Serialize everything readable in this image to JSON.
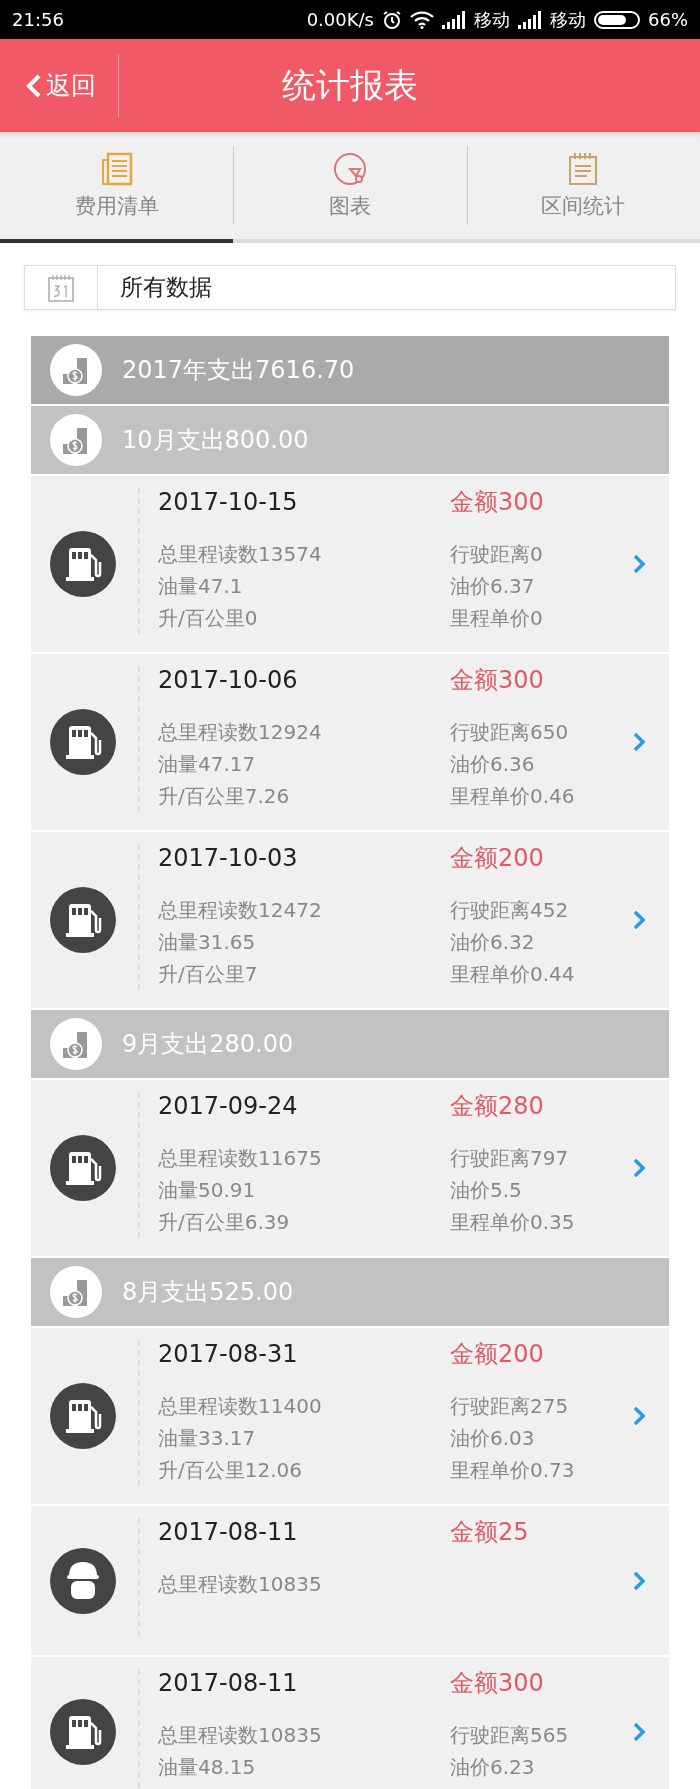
{
  "status_bar": {
    "time": "21:56",
    "speed": "0.00K/s",
    "carriers": [
      "移动",
      "移动"
    ],
    "battery": "66%"
  },
  "header": {
    "back": "返回",
    "title": "统计报表"
  },
  "tabs": [
    {
      "label": "费用清单",
      "selected": true
    },
    {
      "label": "图表",
      "selected": false
    },
    {
      "label": "区间统计",
      "selected": false
    }
  ],
  "date_filter": {
    "value": "所有数据"
  },
  "year_summary": "2017年支出7616.70",
  "months": [
    {
      "summary": "10月支出800.00",
      "entries": [
        {
          "kind": "fuel",
          "date": "2017-10-15",
          "amount": "金额300",
          "left": [
            "总里程读数13574",
            "油量47.1",
            "升/百公里0"
          ],
          "right": [
            "行驶距离0",
            "油价6.37",
            "里程单价0"
          ]
        },
        {
          "kind": "fuel",
          "date": "2017-10-06",
          "amount": "金额300",
          "left": [
            "总里程读数12924",
            "油量47.17",
            "升/百公里7.26"
          ],
          "right": [
            "行驶距离650",
            "油价6.36",
            "里程单价0.46"
          ]
        },
        {
          "kind": "fuel",
          "date": "2017-10-03",
          "amount": "金额200",
          "left": [
            "总里程读数12472",
            "油量31.65",
            "升/百公里7"
          ],
          "right": [
            "行驶距离452",
            "油价6.32",
            "里程单价0.44"
          ]
        }
      ]
    },
    {
      "summary": "9月支出280.00",
      "entries": [
        {
          "kind": "fuel",
          "date": "2017-09-24",
          "amount": "金额280",
          "left": [
            "总里程读数11675",
            "油量50.91",
            "升/百公里6.39"
          ],
          "right": [
            "行驶距离797",
            "油价5.5",
            "里程单价0.35"
          ]
        }
      ]
    },
    {
      "summary": "8月支出525.00",
      "entries": [
        {
          "kind": "fuel",
          "date": "2017-08-31",
          "amount": "金额200",
          "left": [
            "总里程读数11400",
            "油量33.17",
            "升/百公里12.06"
          ],
          "right": [
            "行驶距离275",
            "油价6.03",
            "里程单价0.73"
          ]
        },
        {
          "kind": "repair",
          "date": "2017-08-11",
          "amount": "金额25",
          "left": [
            "总里程读数10835"
          ]
        },
        {
          "kind": "fuel",
          "date": "2017-08-11",
          "amount": "金额300",
          "left": [
            "总里程读数10835",
            "油量48.15"
          ],
          "right": [
            "行驶距离565",
            "油价6.23"
          ]
        }
      ]
    }
  ]
}
